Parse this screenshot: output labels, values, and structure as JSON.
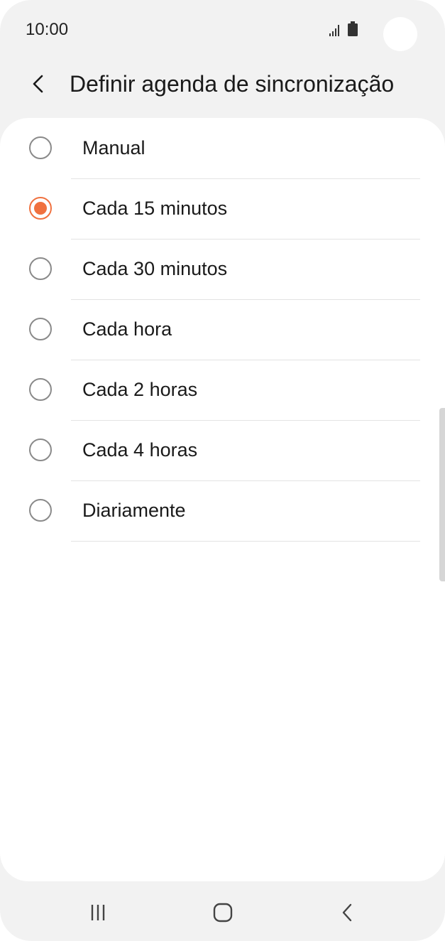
{
  "status_bar": {
    "time": "10:00",
    "icons": [
      "signal-icon",
      "battery-icon"
    ]
  },
  "header": {
    "back_icon": "chevron-left-icon",
    "title": "Definir agenda de sincronização"
  },
  "options": [
    {
      "label": "Manual",
      "selected": false
    },
    {
      "label": "Cada 15 minutos",
      "selected": true
    },
    {
      "label": "Cada 30 minutos",
      "selected": false
    },
    {
      "label": "Cada hora",
      "selected": false
    },
    {
      "label": "Cada 2 horas",
      "selected": false
    },
    {
      "label": "Cada 4 horas",
      "selected": false
    },
    {
      "label": "Diariamente",
      "selected": false
    }
  ],
  "nav_bar": {
    "icons": [
      "recents-icon",
      "home-icon",
      "back-icon"
    ]
  },
  "colors": {
    "accent": "#f0713f",
    "background": "#f2f2f2",
    "card": "#ffffff",
    "text": "#1a1a1a",
    "divider": "#e3e3e3"
  }
}
